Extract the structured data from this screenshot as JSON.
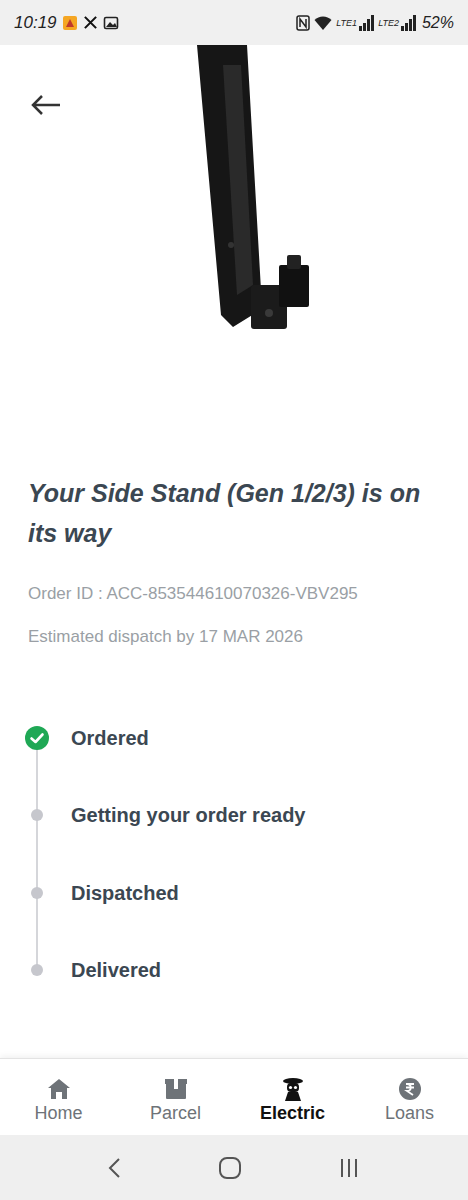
{
  "status_bar": {
    "time": "10:19",
    "sims": [
      {
        "label": "LTE1"
      },
      {
        "label": "LTE2"
      }
    ],
    "battery": "52%"
  },
  "order": {
    "title": "Your Side Stand (Gen 1/2/3) is on its way",
    "order_id": "Order ID : ACC-853544610070326-VBV295",
    "dispatch": "Estimated dispatch by 17 MAR 2026"
  },
  "steps": [
    {
      "label": "Ordered",
      "done": true
    },
    {
      "label": "Getting your order ready",
      "done": false
    },
    {
      "label": "Dispatched",
      "done": false
    },
    {
      "label": "Delivered",
      "done": false
    }
  ],
  "nav": [
    {
      "label": "Home",
      "selected": false
    },
    {
      "label": "Parcel",
      "selected": false
    },
    {
      "label": "Electric",
      "selected": true
    },
    {
      "label": "Loans",
      "selected": false
    }
  ]
}
